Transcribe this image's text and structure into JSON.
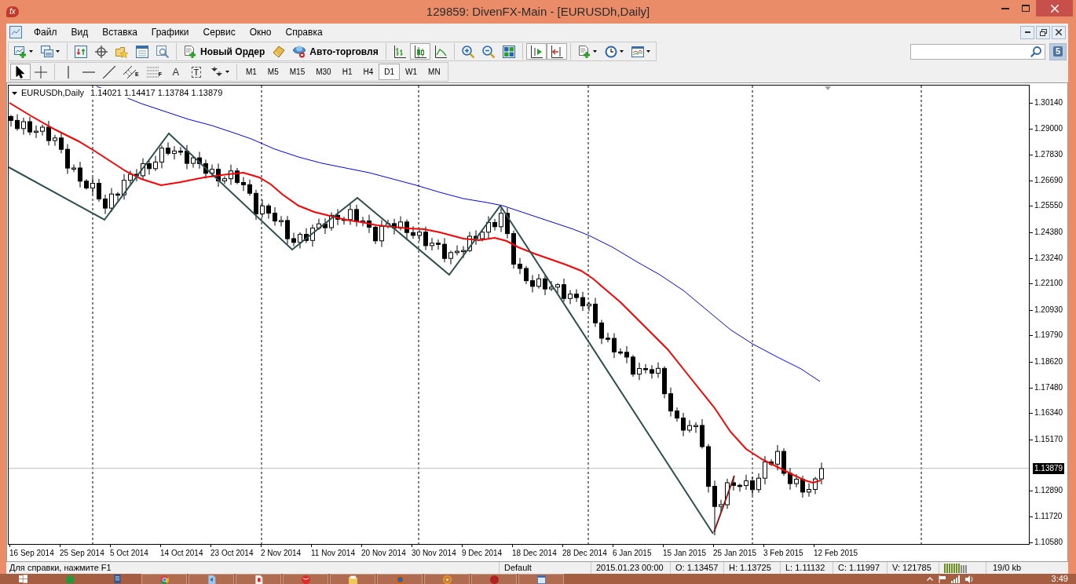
{
  "window": {
    "logo": "fx",
    "title": "129859: DivenFX-Main - [EURUSDh,Daily]"
  },
  "menu": {
    "items": [
      "Файл",
      "Вид",
      "Вставка",
      "Графики",
      "Сервис",
      "Окно",
      "Справка"
    ]
  },
  "toolbar": {
    "groups": [
      [
        {
          "kind": "new_chart",
          "dropdown": true,
          "pressed": false
        },
        {
          "kind": "profiles",
          "dropdown": true,
          "pressed": false
        }
      ],
      [
        {
          "kind": "market_watch",
          "pressed": false
        },
        {
          "kind": "navigator",
          "pressed": false
        },
        {
          "kind": "favorites",
          "pressed": false
        },
        {
          "kind": "terminal",
          "pressed": false
        },
        {
          "kind": "tester",
          "pressed": false
        }
      ],
      [
        {
          "kind": "new_order",
          "label": "Новый Ордер",
          "pressed": false
        },
        {
          "kind": "editor",
          "pressed": false
        },
        {
          "kind": "auto_trading",
          "label": "Авто-торговля",
          "pressed": false
        }
      ],
      [
        {
          "kind": "bar_chart",
          "pressed": false
        },
        {
          "kind": "candle_chart",
          "pressed": true
        },
        {
          "kind": "line_chart",
          "pressed": false
        }
      ],
      [
        {
          "kind": "zoom_in",
          "pressed": false
        },
        {
          "kind": "zoom_out",
          "pressed": false
        },
        {
          "kind": "tile",
          "pressed": false
        }
      ],
      [
        {
          "kind": "chart_shift",
          "pressed": true
        },
        {
          "kind": "auto_scroll",
          "pressed": true
        }
      ],
      [
        {
          "kind": "indicators",
          "dropdown": true,
          "pressed": false
        },
        {
          "kind": "periods",
          "dropdown": true,
          "pressed": false
        },
        {
          "kind": "templates",
          "dropdown": true,
          "pressed": false
        }
      ]
    ]
  },
  "chat": {
    "count": "5"
  },
  "drawing_tools": {
    "groups": [
      [
        {
          "kind": "cursor",
          "pressed": true
        },
        {
          "kind": "crosshair",
          "pressed": false
        }
      ],
      [
        {
          "kind": "vertical_line",
          "pressed": false
        },
        {
          "kind": "horizontal_line",
          "pressed": false
        },
        {
          "kind": "trend_line",
          "pressed": false
        },
        {
          "kind": "channel",
          "glyph": "E",
          "pressed": false
        },
        {
          "kind": "fibonacci",
          "glyph": "F",
          "pressed": false
        },
        {
          "kind": "text",
          "glyph": "A",
          "pressed": false
        },
        {
          "kind": "text_label",
          "glyph": "T",
          "pressed": false
        },
        {
          "kind": "arrows",
          "dropdown": true,
          "pressed": false
        }
      ]
    ]
  },
  "timeframes": [
    {
      "label": "M1",
      "selected": false
    },
    {
      "label": "M5",
      "selected": false
    },
    {
      "label": "M15",
      "selected": false
    },
    {
      "label": "M30",
      "selected": false
    },
    {
      "label": "H1",
      "selected": false
    },
    {
      "label": "H4",
      "selected": false
    },
    {
      "label": "D1",
      "selected": true
    },
    {
      "label": "W1",
      "selected": false
    },
    {
      "label": "MN",
      "selected": false
    }
  ],
  "chart": {
    "symbol": "EURUSDh,Daily",
    "ohlc": "1.14021 1.14417 1.13784 1.13879",
    "price_labels": [
      "1.30140",
      "1.29000",
      "1.27830",
      "1.26690",
      "1.25550",
      "1.24380",
      "1.23240",
      "1.22100",
      "1.20930",
      "1.19790",
      "1.18620",
      "1.17480",
      "1.16340",
      "1.15170",
      "1.12890",
      "1.11720",
      "1.10580"
    ],
    "current_price": "1.13879",
    "date_labels": [
      "16 Sep 2014",
      "25 Sep 2014",
      "5 Oct 2014",
      "14 Oct 2014",
      "23 Oct 2014",
      "2 Nov 2014",
      "11 Nov 2014",
      "20 Nov 2014",
      "30 Nov 2014",
      "9 Dec 2014",
      "18 Dec 2014",
      "28 Dec 2014",
      "6 Jan 2015",
      "15 Jan 2015",
      "25 Jan 2015",
      "3 Feb 2015",
      "12 Feb 2015"
    ]
  },
  "status_bar": {
    "help": "Для справки, нажмите F1",
    "profile": "Default",
    "time": "2015.01.23 00:00",
    "open": "O: 1.13457",
    "high": "H: 1.13725",
    "low": "L: 1.11132",
    "close": "C: 1.11997",
    "volume": "V: 121785",
    "traffic": "19/0 kb"
  },
  "taskbar": {
    "apps": [
      {
        "kind": "start",
        "running": false
      },
      {
        "kind": "bag",
        "running": false
      },
      {
        "kind": "blue_doc",
        "running": false
      },
      {
        "kind": "multicolor_ball",
        "running": true
      },
      {
        "kind": "blue_arrow",
        "running": true
      },
      {
        "kind": "red_letter_doc",
        "running": true
      },
      {
        "kind": "red_ball",
        "running": true
      },
      {
        "kind": "folder",
        "running": true
      },
      {
        "kind": "orange_globe",
        "running": true
      },
      {
        "kind": "orange_ring",
        "running": true
      },
      {
        "kind": "red_circle",
        "running": true
      },
      {
        "kind": "blue_window",
        "running": true
      }
    ],
    "tray": [
      {
        "kind": "chevron"
      },
      {
        "kind": "flag"
      },
      {
        "kind": "network"
      },
      {
        "kind": "speaker"
      }
    ],
    "clock": "3:49"
  }
}
